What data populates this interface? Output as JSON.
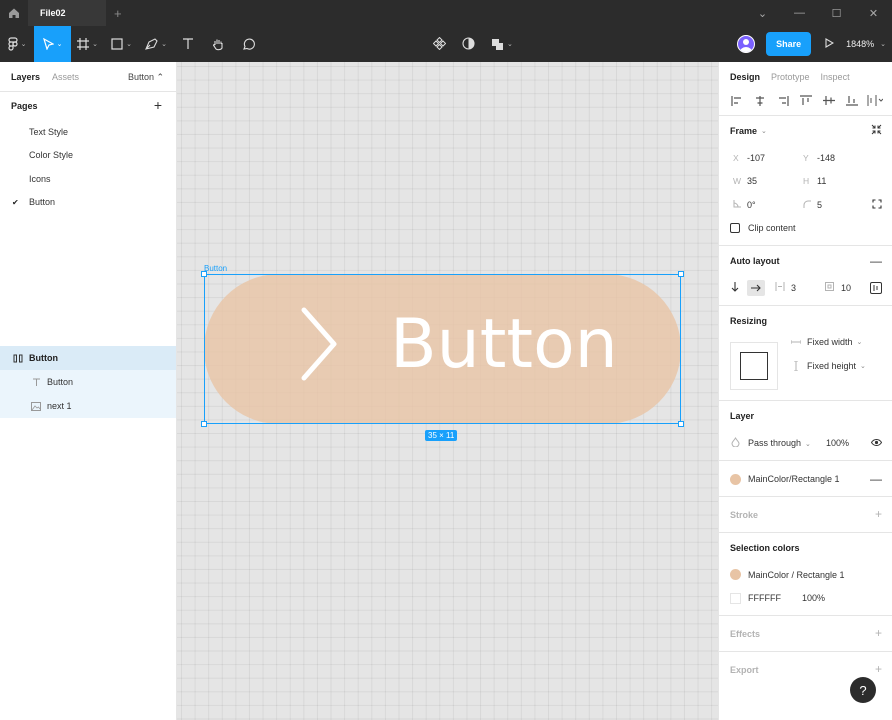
{
  "titlebar": {
    "file_tab": "File02",
    "new_tab": "+",
    "controls": [
      "⌄",
      "—",
      "☐",
      "✕"
    ]
  },
  "toolbar": {
    "share_label": "Share",
    "zoom_label": "1848%"
  },
  "left_panel": {
    "tabs": [
      "Layers",
      "Assets"
    ],
    "page_selector": "Button ⌃",
    "pages_title": "Pages",
    "pages": [
      "Text Style",
      "Color Style",
      "Icons",
      "Button"
    ],
    "current_page_check": "✔",
    "layers": [
      {
        "name": "Button",
        "icon": "auto-layout-frame-icon"
      },
      {
        "name": "Button",
        "icon": "text-layer-icon"
      },
      {
        "name": "next 1",
        "icon": "image-layer-icon"
      }
    ]
  },
  "canvas": {
    "frame_label": "Button",
    "button_text": "Button",
    "size_badge": "35 × 11",
    "fill_color": "#e8c4a5",
    "selection_color": "#18a0fb"
  },
  "right_panel": {
    "tabs": [
      "Design",
      "Prototype",
      "Inspect"
    ],
    "frame": {
      "title": "Frame",
      "x_label": "X",
      "x": "-107",
      "y_label": "Y",
      "y": "-148",
      "w_label": "W",
      "w": "35",
      "h_label": "H",
      "h": "11",
      "rotation": "0°",
      "radius": "5",
      "clip_content": "Clip content"
    },
    "auto_layout": {
      "title": "Auto layout",
      "spacing": "3",
      "padding": "10"
    },
    "resizing": {
      "title": "Resizing",
      "width": "Fixed width",
      "height": "Fixed height"
    },
    "layer": {
      "title": "Layer",
      "blend": "Pass through",
      "opacity": "100%"
    },
    "fill": {
      "style_name": "MainColor/Rectangle 1"
    },
    "stroke": {
      "title": "Stroke"
    },
    "selection_colors": {
      "title": "Selection colors",
      "items": [
        {
          "name": "MainColor / Rectangle 1",
          "color": "#e8c4a5"
        },
        {
          "name": "FFFFFF",
          "opacity": "100%",
          "color": "#ffffff"
        }
      ]
    },
    "effects": {
      "title": "Effects"
    },
    "export": {
      "title": "Export"
    }
  },
  "help": "?"
}
